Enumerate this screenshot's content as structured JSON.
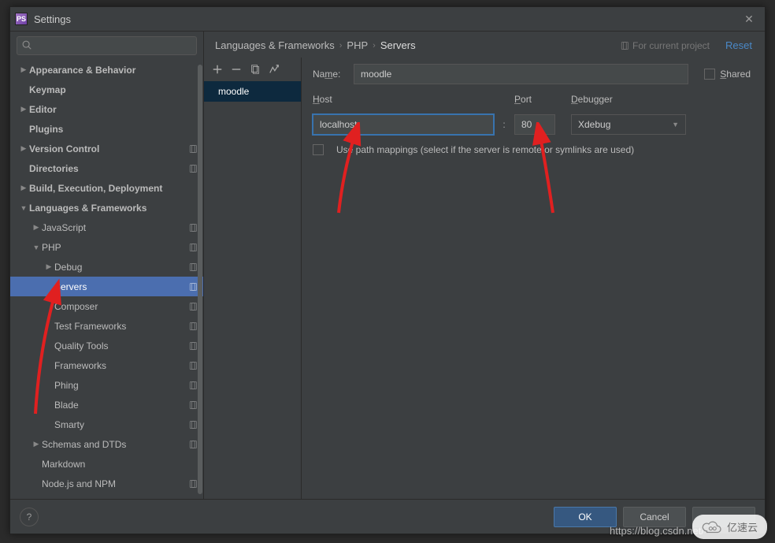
{
  "window": {
    "title": "Settings",
    "app_abbr": "PS"
  },
  "search_placeholder": "",
  "tree": [
    {
      "id": "appearance",
      "label": "Appearance & Behavior",
      "indent": 0,
      "arrow": "▶",
      "bold": true
    },
    {
      "id": "keymap",
      "label": "Keymap",
      "indent": 0,
      "arrow": "",
      "bold": true
    },
    {
      "id": "editor",
      "label": "Editor",
      "indent": 0,
      "arrow": "▶",
      "bold": true
    },
    {
      "id": "plugins",
      "label": "Plugins",
      "indent": 0,
      "arrow": "",
      "bold": true
    },
    {
      "id": "vcs",
      "label": "Version Control",
      "indent": 0,
      "arrow": "▶",
      "bold": true,
      "profile": true
    },
    {
      "id": "directories",
      "label": "Directories",
      "indent": 0,
      "arrow": "",
      "bold": true,
      "profile": true
    },
    {
      "id": "build",
      "label": "Build, Execution, Deployment",
      "indent": 0,
      "arrow": "▶",
      "bold": true
    },
    {
      "id": "langfw",
      "label": "Languages & Frameworks",
      "indent": 0,
      "arrow": "▼",
      "bold": true
    },
    {
      "id": "javascript",
      "label": "JavaScript",
      "indent": 1,
      "arrow": "▶",
      "profile": true
    },
    {
      "id": "php",
      "label": "PHP",
      "indent": 1,
      "arrow": "▼",
      "profile": true
    },
    {
      "id": "debug",
      "label": "Debug",
      "indent": 2,
      "arrow": "▶",
      "profile": true
    },
    {
      "id": "servers",
      "label": "Servers",
      "indent": 2,
      "arrow": "",
      "profile": true,
      "selected": true
    },
    {
      "id": "composer",
      "label": "Composer",
      "indent": 2,
      "arrow": "",
      "profile": true
    },
    {
      "id": "testfw",
      "label": "Test Frameworks",
      "indent": 2,
      "arrow": "",
      "profile": true
    },
    {
      "id": "qtools",
      "label": "Quality Tools",
      "indent": 2,
      "arrow": "",
      "profile": true
    },
    {
      "id": "frameworks",
      "label": "Frameworks",
      "indent": 2,
      "arrow": "",
      "profile": true
    },
    {
      "id": "phing",
      "label": "Phing",
      "indent": 2,
      "arrow": "",
      "profile": true
    },
    {
      "id": "blade",
      "label": "Blade",
      "indent": 2,
      "arrow": "",
      "profile": true
    },
    {
      "id": "smarty",
      "label": "Smarty",
      "indent": 2,
      "arrow": "",
      "profile": true
    },
    {
      "id": "schemas",
      "label": "Schemas and DTDs",
      "indent": 1,
      "arrow": "▶",
      "profile": true
    },
    {
      "id": "markdown",
      "label": "Markdown",
      "indent": 1,
      "arrow": ""
    },
    {
      "id": "node",
      "label": "Node.js and NPM",
      "indent": 1,
      "arrow": "",
      "profile": true
    }
  ],
  "breadcrumbs": [
    "Languages & Frameworks",
    "PHP",
    "Servers"
  ],
  "for_project": "For current project",
  "reset": "Reset",
  "servers_list": [
    {
      "name": "moodle",
      "selected": true
    }
  ],
  "form": {
    "name_label": "Name:",
    "name_value": "moodle",
    "shared_label": "Shared",
    "host_label": "Host",
    "host_value": "localhost",
    "port_label": "Port",
    "port_value": "80",
    "debugger_label": "Debugger",
    "debugger_value": "Xdebug",
    "use_mappings_label": "Use path mappings (select if the server is remote or symlinks are used)"
  },
  "buttons": {
    "ok": "OK",
    "cancel": "Cancel"
  },
  "watermark1": "亿速云",
  "watermark2": "https://blog.csdn.net/"
}
